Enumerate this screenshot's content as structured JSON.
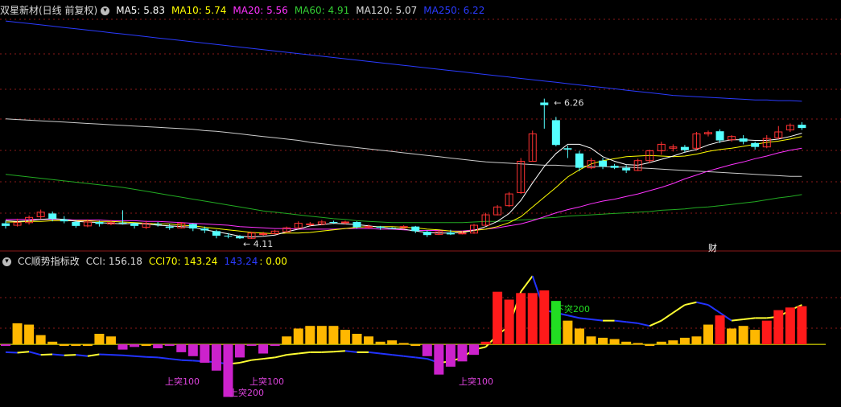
{
  "main": {
    "title": "双星新材(日线 前复权)",
    "ma": [
      {
        "label": "MA5: 5.83",
        "color": "#ffffff"
      },
      {
        "label": "MA10: 5.74",
        "color": "#ffff00"
      },
      {
        "label": "MA20: 5.56",
        "color": "#ff33ff"
      },
      {
        "label": "MA60: 4.91",
        "color": "#33cc33"
      },
      {
        "label": "MA120: 5.07",
        "color": "#dddddd"
      },
      {
        "label": "MA250: 6.22",
        "color": "#2a3bff"
      }
    ],
    "high_label": "6.26",
    "low_label": "4.11",
    "marker": "财",
    "candles": [
      [
        4.35,
        4.31,
        4.39,
        4.27
      ],
      [
        4.32,
        4.36,
        4.42,
        4.3
      ],
      [
        4.36,
        4.44,
        4.47,
        4.33
      ],
      [
        4.45,
        4.52,
        4.56,
        4.42
      ],
      [
        4.5,
        4.42,
        4.53,
        4.38
      ],
      [
        4.41,
        4.38,
        4.46,
        4.35
      ],
      [
        4.37,
        4.31,
        4.4,
        4.28
      ],
      [
        4.31,
        4.37,
        4.41,
        4.29
      ],
      [
        4.37,
        4.34,
        4.39,
        4.3
      ],
      [
        4.34,
        4.36,
        4.4,
        4.32
      ],
      [
        4.36,
        4.35,
        4.55,
        4.33
      ],
      [
        4.35,
        4.31,
        4.36,
        4.27
      ],
      [
        4.29,
        4.35,
        4.39,
        4.26
      ],
      [
        4.34,
        4.33,
        4.37,
        4.3
      ],
      [
        4.3,
        4.28,
        4.34,
        4.25
      ],
      [
        4.28,
        4.35,
        4.37,
        4.27
      ],
      [
        4.34,
        4.27,
        4.35,
        4.23
      ],
      [
        4.27,
        4.24,
        4.3,
        4.2
      ],
      [
        4.23,
        4.16,
        4.25,
        4.12
      ],
      [
        4.16,
        4.15,
        4.2,
        4.12
      ],
      [
        4.15,
        4.12,
        4.17,
        4.11
      ],
      [
        4.12,
        4.2,
        4.22,
        4.11
      ],
      [
        4.19,
        4.19,
        4.22,
        4.16
      ],
      [
        4.19,
        4.23,
        4.25,
        4.18
      ],
      [
        4.22,
        4.28,
        4.3,
        4.21
      ],
      [
        4.28,
        4.35,
        4.38,
        4.27
      ],
      [
        4.33,
        4.34,
        4.37,
        4.31
      ],
      [
        4.34,
        4.37,
        4.4,
        4.32
      ],
      [
        4.37,
        4.36,
        4.39,
        4.34
      ],
      [
        4.36,
        4.37,
        4.39,
        4.33
      ],
      [
        4.37,
        4.29,
        4.38,
        4.27
      ],
      [
        4.29,
        4.3,
        4.33,
        4.27
      ],
      [
        4.3,
        4.28,
        4.31,
        4.25
      ],
      [
        4.28,
        4.27,
        4.29,
        4.26
      ],
      [
        4.28,
        4.3,
        4.32,
        4.26
      ],
      [
        4.3,
        4.23,
        4.31,
        4.2
      ],
      [
        4.22,
        4.17,
        4.24,
        4.14
      ],
      [
        4.18,
        4.22,
        4.24,
        4.17
      ],
      [
        4.21,
        4.18,
        4.25,
        4.17
      ],
      [
        4.19,
        4.2,
        4.23,
        4.18
      ],
      [
        4.2,
        4.32,
        4.34,
        4.19
      ],
      [
        4.32,
        4.48,
        4.51,
        4.31
      ],
      [
        4.48,
        4.6,
        4.63,
        4.47
      ],
      [
        4.62,
        4.8,
        4.83,
        4.6
      ],
      [
        4.82,
        5.3,
        5.35,
        4.8
      ],
      [
        5.3,
        5.72,
        5.77,
        5.3
      ],
      [
        6.2,
        6.16,
        6.26,
        5.8
      ],
      [
        5.93,
        5.55,
        5.98,
        5.53
      ],
      [
        5.5,
        5.48,
        5.54,
        5.35
      ],
      [
        5.42,
        5.2,
        5.46,
        5.15
      ],
      [
        5.2,
        5.31,
        5.35,
        5.18
      ],
      [
        5.31,
        5.22,
        5.35,
        5.18
      ],
      [
        5.23,
        5.2,
        5.26,
        5.18
      ],
      [
        5.2,
        5.16,
        5.24,
        5.12
      ],
      [
        5.16,
        5.31,
        5.34,
        5.15
      ],
      [
        5.31,
        5.46,
        5.48,
        5.27
      ],
      [
        5.46,
        5.56,
        5.6,
        5.4
      ],
      [
        5.5,
        5.52,
        5.56,
        5.45
      ],
      [
        5.52,
        5.47,
        5.55,
        5.44
      ],
      [
        5.5,
        5.72,
        5.75,
        5.48
      ],
      [
        5.72,
        5.74,
        5.77,
        5.68
      ],
      [
        5.76,
        5.62,
        5.79,
        5.58
      ],
      [
        5.63,
        5.68,
        5.7,
        5.6
      ],
      [
        5.65,
        5.6,
        5.7,
        5.56
      ],
      [
        5.58,
        5.52,
        5.6,
        5.48
      ],
      [
        5.52,
        5.65,
        5.7,
        5.5
      ],
      [
        5.66,
        5.75,
        5.84,
        5.64
      ],
      [
        5.78,
        5.85,
        5.88,
        5.75
      ],
      [
        5.86,
        5.81,
        5.9,
        5.78
      ]
    ],
    "ma5": [
      4.39,
      4.38,
      4.39,
      4.41,
      4.42,
      4.41,
      4.38,
      4.37,
      4.36,
      4.35,
      4.34,
      4.35,
      4.34,
      4.32,
      4.31,
      4.3,
      4.29,
      4.25,
      4.22,
      4.19,
      4.15,
      4.14,
      4.15,
      4.17,
      4.22,
      4.26,
      4.31,
      4.33,
      4.35,
      4.34,
      4.33,
      4.31,
      4.29,
      4.27,
      4.26,
      4.23,
      4.21,
      4.2,
      4.2,
      4.21,
      4.24,
      4.3,
      4.38,
      4.5,
      4.7,
      4.97,
      5.22,
      5.42,
      5.56,
      5.56,
      5.5,
      5.37,
      5.3,
      5.25,
      5.24,
      5.28,
      5.33,
      5.38,
      5.44,
      5.48,
      5.55,
      5.6,
      5.63,
      5.63,
      5.62,
      5.62,
      5.64,
      5.68,
      5.73
    ],
    "ma10": [
      4.37,
      4.37,
      4.38,
      4.38,
      4.39,
      4.39,
      4.39,
      4.39,
      4.38,
      4.38,
      4.37,
      4.36,
      4.35,
      4.34,
      4.34,
      4.32,
      4.31,
      4.29,
      4.27,
      4.25,
      4.23,
      4.21,
      4.2,
      4.19,
      4.2,
      4.2,
      4.21,
      4.23,
      4.25,
      4.27,
      4.29,
      4.3,
      4.3,
      4.3,
      4.29,
      4.28,
      4.26,
      4.25,
      4.23,
      4.22,
      4.24,
      4.26,
      4.3,
      4.36,
      4.45,
      4.6,
      4.75,
      4.9,
      5.06,
      5.17,
      5.26,
      5.31,
      5.34,
      5.37,
      5.38,
      5.39,
      5.38,
      5.37,
      5.38,
      5.41,
      5.45,
      5.48,
      5.5,
      5.53,
      5.56,
      5.59,
      5.61,
      5.64,
      5.68
    ],
    "ma20": [
      4.41,
      4.41,
      4.41,
      4.41,
      4.41,
      4.41,
      4.4,
      4.4,
      4.4,
      4.39,
      4.39,
      4.39,
      4.38,
      4.38,
      4.37,
      4.36,
      4.35,
      4.34,
      4.33,
      4.32,
      4.3,
      4.29,
      4.28,
      4.27,
      4.27,
      4.26,
      4.26,
      4.26,
      4.26,
      4.27,
      4.27,
      4.27,
      4.26,
      4.26,
      4.25,
      4.24,
      4.24,
      4.24,
      4.23,
      4.23,
      4.25,
      4.26,
      4.28,
      4.31,
      4.34,
      4.39,
      4.45,
      4.51,
      4.56,
      4.6,
      4.65,
      4.69,
      4.72,
      4.76,
      4.8,
      4.85,
      4.9,
      4.96,
      5.03,
      5.09,
      5.15,
      5.2,
      5.25,
      5.29,
      5.34,
      5.38,
      5.43,
      5.47,
      5.5
    ],
    "ma60": [
      5.1,
      5.08,
      5.06,
      5.04,
      5.02,
      5.0,
      4.98,
      4.96,
      4.94,
      4.92,
      4.9,
      4.87,
      4.84,
      4.81,
      4.78,
      4.75,
      4.72,
      4.69,
      4.66,
      4.63,
      4.6,
      4.57,
      4.54,
      4.52,
      4.5,
      4.48,
      4.46,
      4.44,
      4.42,
      4.41,
      4.39,
      4.38,
      4.37,
      4.36,
      4.36,
      4.36,
      4.36,
      4.36,
      4.36,
      4.36,
      4.37,
      4.38,
      4.38,
      4.39,
      4.4,
      4.41,
      4.43,
      4.44,
      4.46,
      4.47,
      4.48,
      4.49,
      4.5,
      4.51,
      4.52,
      4.53,
      4.55,
      4.56,
      4.57,
      4.59,
      4.6,
      4.62,
      4.64,
      4.66,
      4.68,
      4.71,
      4.74,
      4.76,
      4.79
    ],
    "ma120": [
      5.95,
      5.94,
      5.93,
      5.92,
      5.91,
      5.9,
      5.89,
      5.88,
      5.87,
      5.86,
      5.85,
      5.84,
      5.83,
      5.82,
      5.81,
      5.8,
      5.79,
      5.77,
      5.76,
      5.74,
      5.72,
      5.7,
      5.68,
      5.66,
      5.64,
      5.62,
      5.59,
      5.57,
      5.55,
      5.53,
      5.51,
      5.49,
      5.47,
      5.45,
      5.43,
      5.41,
      5.39,
      5.37,
      5.35,
      5.33,
      5.31,
      5.29,
      5.28,
      5.27,
      5.26,
      5.25,
      5.24,
      5.24,
      5.23,
      5.23,
      5.22,
      5.22,
      5.21,
      5.21,
      5.2,
      5.19,
      5.18,
      5.17,
      5.16,
      5.15,
      5.14,
      5.13,
      5.12,
      5.11,
      5.1,
      5.09,
      5.08,
      5.07,
      5.07
    ],
    "ma250": [
      7.45,
      7.43,
      7.41,
      7.39,
      7.37,
      7.35,
      7.33,
      7.31,
      7.29,
      7.27,
      7.25,
      7.23,
      7.21,
      7.19,
      7.17,
      7.15,
      7.13,
      7.11,
      7.09,
      7.07,
      7.05,
      7.03,
      7.01,
      6.99,
      6.97,
      6.95,
      6.93,
      6.91,
      6.89,
      6.87,
      6.85,
      6.83,
      6.81,
      6.79,
      6.77,
      6.75,
      6.73,
      6.71,
      6.69,
      6.67,
      6.65,
      6.63,
      6.61,
      6.59,
      6.57,
      6.55,
      6.53,
      6.51,
      6.49,
      6.47,
      6.45,
      6.43,
      6.41,
      6.39,
      6.37,
      6.35,
      6.33,
      6.31,
      6.3,
      6.29,
      6.28,
      6.27,
      6.26,
      6.25,
      6.24,
      6.24,
      6.23,
      6.23,
      6.22
    ]
  },
  "indicator": {
    "title": "CC顺势指标改",
    "cci_label": "CCI: 156.18",
    "cci70_label": "CCI70: 143.24",
    "blue_label": "143.24",
    "zero_label": ": 0.00",
    "annotations": {
      "xia_tu": "下突200",
      "shang_tu": "上突100",
      "shang_tu_200": "上突200"
    },
    "bars": [
      -5,
      80,
      75,
      35,
      10,
      0,
      0,
      0,
      40,
      30,
      -20,
      -10,
      0,
      -15,
      -5,
      -30,
      -45,
      -70,
      -100,
      -200,
      -50,
      -5,
      -35,
      -5,
      30,
      60,
      70,
      70,
      70,
      55,
      40,
      30,
      10,
      15,
      5,
      0,
      -45,
      -115,
      -85,
      -65,
      -40,
      10,
      200,
      170,
      195,
      195,
      205,
      165,
      90,
      60,
      30,
      25,
      20,
      10,
      5,
      0,
      10,
      15,
      25,
      30,
      75,
      110,
      60,
      70,
      55,
      90,
      130,
      140,
      145
    ],
    "cci70": [
      -30,
      -32,
      -28,
      -40,
      -38,
      -42,
      -40,
      -45,
      -38,
      -40,
      -42,
      -45,
      -48,
      -50,
      -55,
      -60,
      -62,
      -65,
      -68,
      -75,
      -70,
      -60,
      -55,
      -50,
      -40,
      -35,
      -30,
      -30,
      -28,
      -25,
      -30,
      -30,
      -35,
      -40,
      -45,
      -50,
      -55,
      -70,
      -65,
      -50,
      -20,
      -10,
      35,
      70,
      200,
      260,
      130,
      120,
      110,
      100,
      95,
      90,
      90,
      85,
      80,
      70,
      90,
      120,
      150,
      160,
      150,
      120,
      90,
      95,
      100,
      100,
      105,
      130,
      150
    ]
  }
}
